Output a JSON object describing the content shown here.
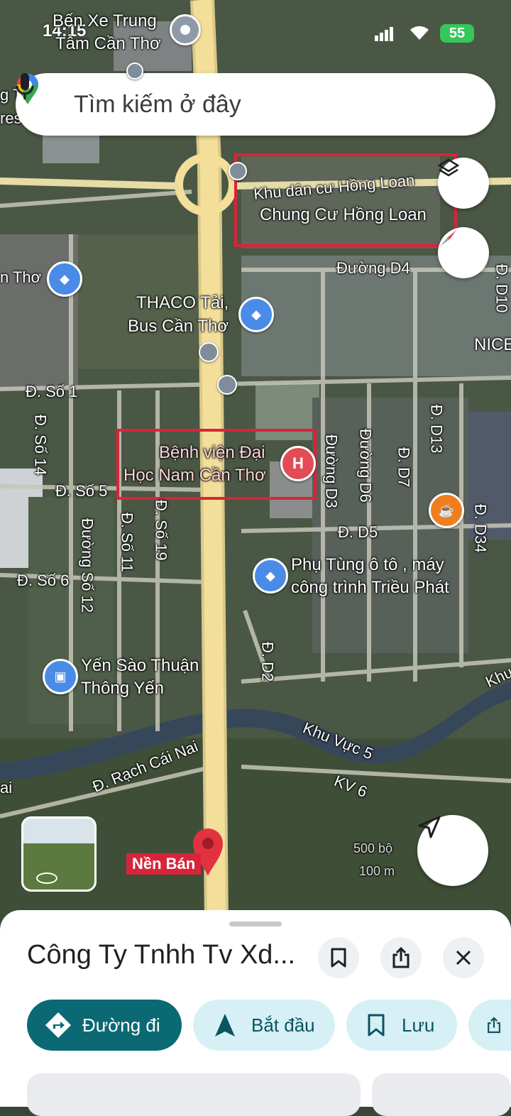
{
  "status_bar": {
    "time": "14:15",
    "battery": "55"
  },
  "search": {
    "placeholder": "Tìm kiếm ở đây"
  },
  "map": {
    "labels": {
      "ben_xe_1": "Bến Xe Trung",
      "ben_xe_2": "Tâm Cần Thơ",
      "hong_loan_area": "Khu dân cư Hồng Loan",
      "hong_loan_apartment": "Chung Cư Hồng Loan",
      "duong_d4": "Đường D4",
      "d_d10": "Đ. D10",
      "nice": "NICE",
      "thaco_1": "THACO Tải,",
      "thaco_2": "Bus Cần Thơ",
      "can_tho_left": "n Thơ",
      "d_so_1": "Đ. Số 1",
      "d_so_14": "Đ. Số 14",
      "d_so_5": "Đ. Số 5",
      "duong_so_12": "Đường Số 12",
      "d_so_11": "Đ. Số 11",
      "d_so_19": "Đ. Số 19",
      "d_so_6": "Đ. Số 6",
      "hospital_1": "Bệnh viện Đại",
      "hospital_2": "Học Nam Cần Thơ",
      "duong_d3": "Đường D3",
      "duong_d6": "Đường D6",
      "d_d7": "Đ. D7",
      "d_d13": "Đ. D13",
      "d_d34": "Đ. D34",
      "d_d5": "Đ. D5",
      "phu_tung_1": "Phụ Tùng ô tô , máy",
      "phu_tung_2": "công trình Triều Phát",
      "d_d2": "Đ. D2",
      "yen_sao_1": "Yến Sào Thuận",
      "yen_sao_2": "Thông Yến",
      "khu_vuc_5": "Khu Vực 5",
      "kv6": "KV 6",
      "rach_cai_nai": "Đ. Rạch Cái Nai",
      "khu_right": "Khu",
      "left_g": "g T",
      "left_res": "res",
      "left_ai": "ai",
      "scale_ft": "500 bộ",
      "scale_m": "100 m",
      "nen_ban": "Nền Bán"
    },
    "colors": {
      "highlight": "#d8243a",
      "road": "#f3df9a",
      "shop_pin": "#4a8be8",
      "hospital_pin": "#e24c55",
      "cafe_pin": "#f07e1f"
    }
  },
  "place": {
    "title": "Công Ty Tnhh Tv Xd...",
    "actions": {
      "directions": "Đường đi",
      "start": "Bắt đầu",
      "save": "Lưu"
    }
  }
}
